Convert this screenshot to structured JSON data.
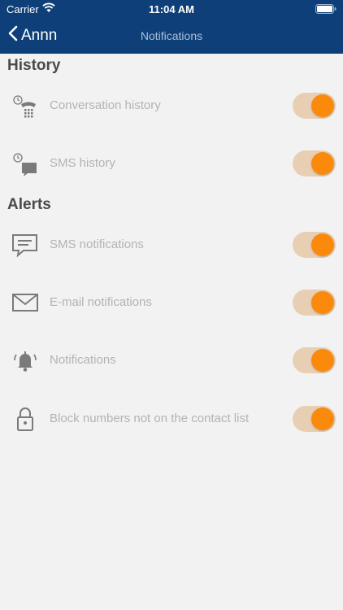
{
  "status_bar": {
    "carrier": "Carrier",
    "time": "11:04 AM"
  },
  "nav": {
    "back_label": "Annn",
    "title": "Notifications"
  },
  "sections": {
    "history": {
      "title": "History",
      "items": [
        {
          "label": "Conversation history",
          "icon": "phone-history-icon",
          "enabled": true
        },
        {
          "label": "SMS history",
          "icon": "sms-history-icon",
          "enabled": true
        }
      ]
    },
    "alerts": {
      "title": "Alerts",
      "items": [
        {
          "label": "SMS notifications",
          "icon": "chat-bubble-icon",
          "enabled": true
        },
        {
          "label": "E-mail notifications",
          "icon": "envelope-icon",
          "enabled": true
        },
        {
          "label": "Notifications",
          "icon": "bell-icon",
          "enabled": true
        },
        {
          "label": "Block numbers not on the contact list",
          "icon": "lock-icon",
          "enabled": true
        }
      ]
    }
  },
  "colors": {
    "nav_background": "#0f3f78",
    "toggle_track": "#e8cfb3",
    "toggle_knob": "#fb8a0c",
    "icon": "#7a7a7a",
    "label": "#b3b3b3"
  }
}
